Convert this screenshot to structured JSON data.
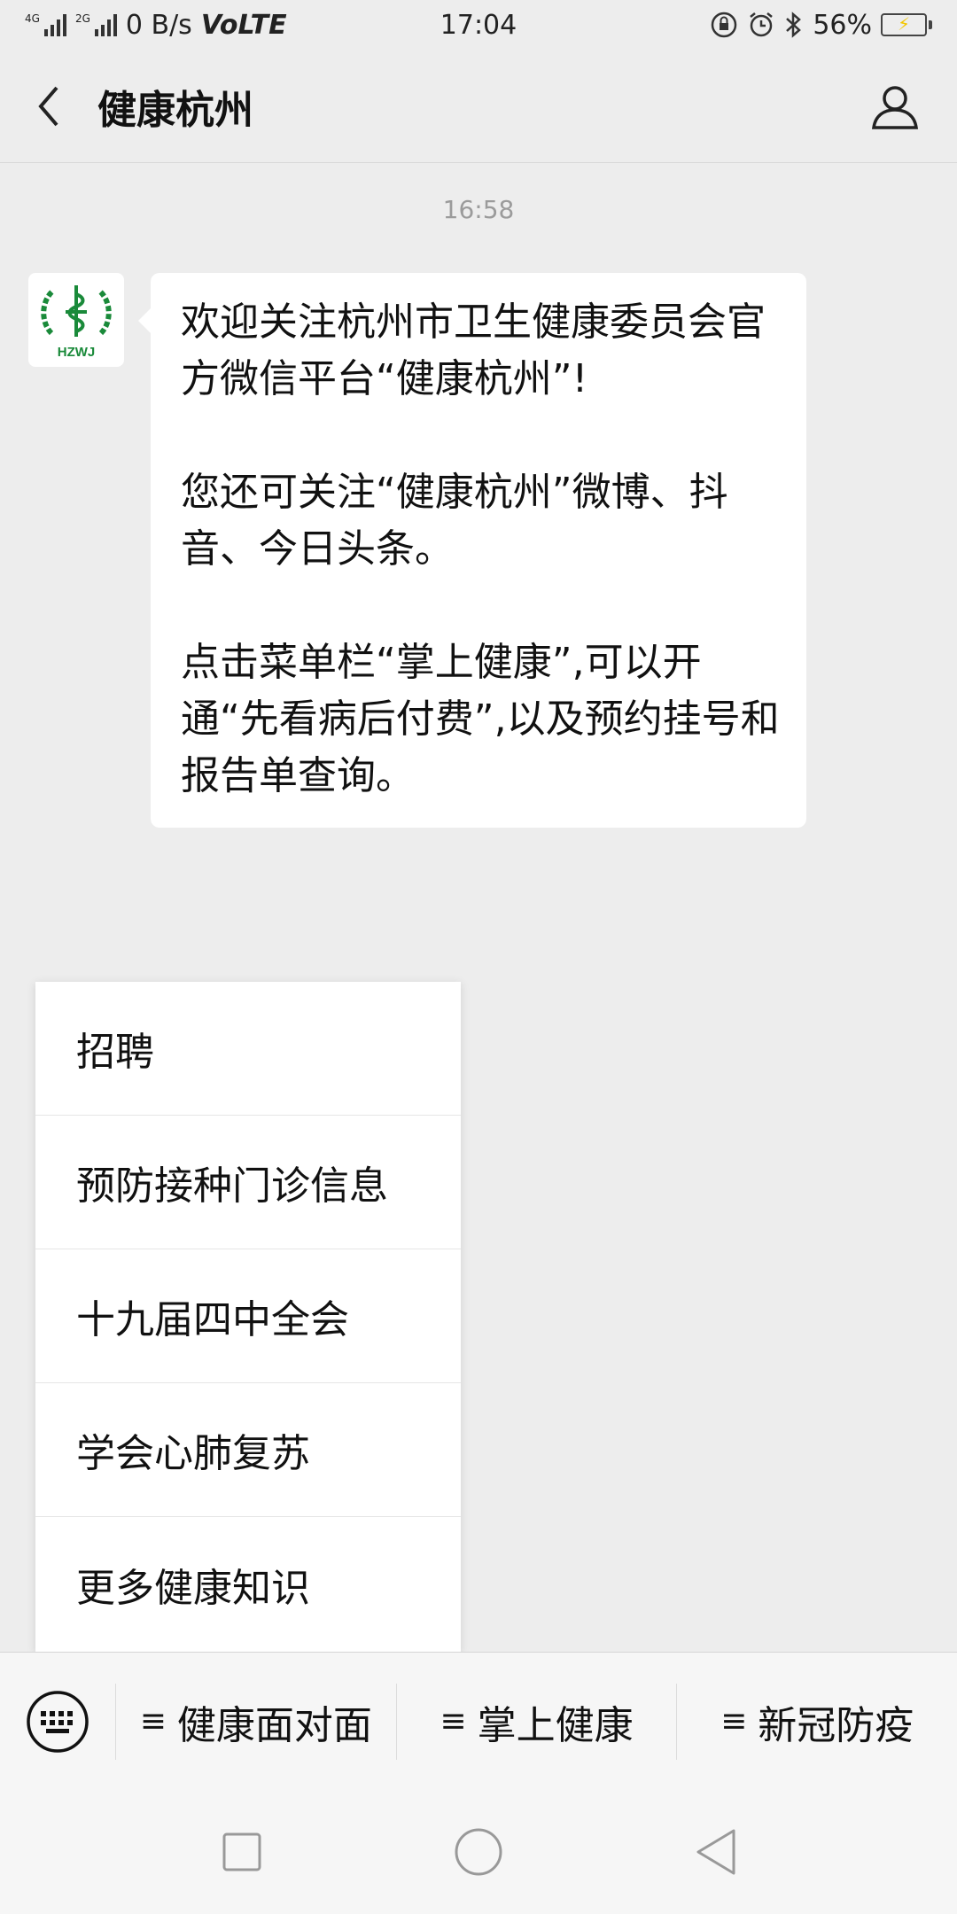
{
  "status_bar": {
    "net_primary": "4G",
    "net_secondary": "2G",
    "speed": "0 B/s",
    "volte": "VoLTE",
    "time": "17:04",
    "battery": "56%",
    "battery_level": 0.56
  },
  "header": {
    "title": "健康杭州"
  },
  "chat": {
    "timestamp": "16:58",
    "avatar_text": "HZWJ",
    "message_paragraphs": [
      "欢迎关注杭州市卫生健康委员会官方微信平台“健康杭州”!",
      "您还可关注“健康杭州”微博、抖音、今日头条。",
      "点击菜单栏“掌上健康”,可以开通“先看病后付费”,以及预约挂号和报告单查询。"
    ]
  },
  "popup_menu": {
    "items": [
      "招聘",
      "预防接种门诊信息",
      "十九届四中全会",
      "学会心肺复苏",
      "更多健康知识"
    ]
  },
  "menu_bar": {
    "tabs": [
      "健康面对面",
      "掌上健康",
      "新冠防疫"
    ],
    "hamburger": "≡"
  },
  "colors": {
    "background": "#ededed",
    "logo_green": "#1a8a3a"
  }
}
